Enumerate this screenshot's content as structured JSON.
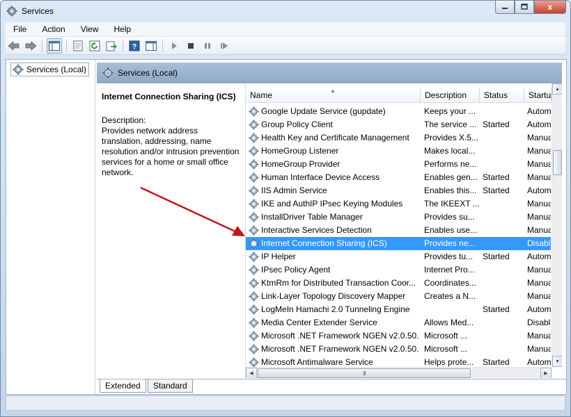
{
  "window": {
    "title": "Services",
    "min_label": "",
    "max_label": "",
    "close_label": "x"
  },
  "menu": [
    "File",
    "Action",
    "View",
    "Help"
  ],
  "toolbar_icons": [
    "back-icon",
    "forward-icon",
    "console-tree-icon",
    "properties-icon",
    "refresh-icon",
    "export-icon",
    "help-icon",
    "action-pane-icon",
    "play-icon",
    "stop-icon",
    "pause-icon",
    "restart-icon"
  ],
  "tree": {
    "root_label": "Services (Local)"
  },
  "header": {
    "title": "Services (Local)"
  },
  "details": {
    "service_name": "Internet Connection Sharing (ICS)",
    "description_label": "Description:",
    "description_text": "Provides network address translation, addressing, name resolution and/or intrusion prevention services for a home or small office network."
  },
  "columns": {
    "name": "Name",
    "description": "Description",
    "status": "Status",
    "startup": "Startup"
  },
  "services": [
    {
      "name": "Google Update Service (gupdate)",
      "description": "Keeps your ...",
      "status": "",
      "startup": "Autom"
    },
    {
      "name": "Group Policy Client",
      "description": "The service ...",
      "status": "Started",
      "startup": "Autom"
    },
    {
      "name": "Health Key and Certificate Management",
      "description": "Provides X.5...",
      "status": "",
      "startup": "Manua"
    },
    {
      "name": "HomeGroup Listener",
      "description": "Makes local...",
      "status": "",
      "startup": "Manua"
    },
    {
      "name": "HomeGroup Provider",
      "description": "Performs ne...",
      "status": "",
      "startup": "Manua"
    },
    {
      "name": "Human Interface Device Access",
      "description": "Enables gen...",
      "status": "Started",
      "startup": "Manua"
    },
    {
      "name": "IIS Admin Service",
      "description": "Enables this...",
      "status": "Started",
      "startup": "Autom"
    },
    {
      "name": "IKE and AuthIP IPsec Keying Modules",
      "description": "The IKEEXT ...",
      "status": "",
      "startup": "Manua"
    },
    {
      "name": "InstallDriver Table Manager",
      "description": "Provides su...",
      "status": "",
      "startup": "Manua"
    },
    {
      "name": "Interactive Services Detection",
      "description": "Enables use...",
      "status": "",
      "startup": "Manua"
    },
    {
      "name": "Internet Connection Sharing (ICS)",
      "description": "Provides ne...",
      "status": "",
      "startup": "Disable",
      "selected": true
    },
    {
      "name": "IP Helper",
      "description": "Provides tu...",
      "status": "Started",
      "startup": "Autom"
    },
    {
      "name": "IPsec Policy Agent",
      "description": "Internet Pro...",
      "status": "",
      "startup": "Manua"
    },
    {
      "name": "KtmRm for Distributed Transaction Coor...",
      "description": "Coordinates...",
      "status": "",
      "startup": "Manua"
    },
    {
      "name": "Link-Layer Topology Discovery Mapper",
      "description": "Creates a N...",
      "status": "",
      "startup": "Manua"
    },
    {
      "name": "LogMeIn Hamachi 2.0 Tunneling Engine",
      "description": "",
      "status": "Started",
      "startup": "Autom"
    },
    {
      "name": "Media Center Extender Service",
      "description": "Allows Med...",
      "status": "",
      "startup": "Disable"
    },
    {
      "name": "Microsoft .NET Framework NGEN v2.0.50...",
      "description": "Microsoft ...",
      "status": "",
      "startup": "Manua"
    },
    {
      "name": "Microsoft .NET Framework NGEN v2.0.50...",
      "description": "Microsoft ...",
      "status": "",
      "startup": "Manua"
    },
    {
      "name": "Microsoft Antimalware Service",
      "description": "Helps prote...",
      "status": "Started",
      "startup": "Autom"
    }
  ],
  "hscroll_grip": "III",
  "tabs": {
    "extended": "Extended",
    "standard": "Standard"
  },
  "colors": {
    "selection": "#3399ff",
    "annotation_arrow": "#c0161c",
    "header_band": "#9db4cf"
  }
}
